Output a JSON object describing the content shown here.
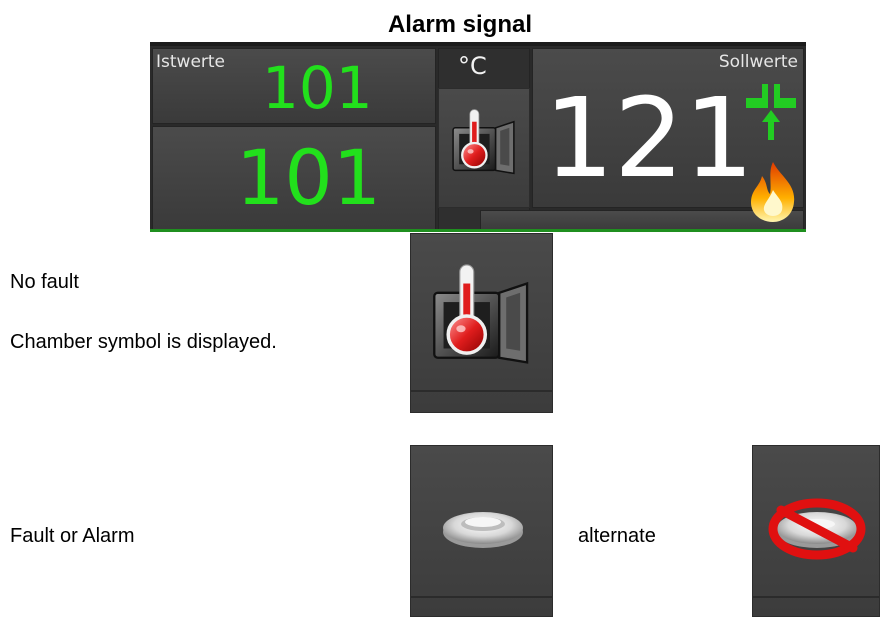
{
  "heading": "Alarm signal",
  "display": {
    "actual_label": "Istwerte",
    "setpoint_label": "Sollwerte",
    "actual_value_top": "101",
    "actual_value_bottom": "101",
    "unit": "°C",
    "setpoint_value": "121",
    "icons": [
      "thermometer-chamber-icon",
      "steam-valve-icon",
      "flame-icon"
    ]
  },
  "rows": [
    {
      "lines": [
        "No fault",
        "Chamber symbol is displayed."
      ],
      "icon": "thermometer-chamber-icon"
    },
    {
      "label": "Fault or Alarm",
      "icon_a": "lamp-icon",
      "between": "alternate",
      "icon_b": "prohibited-lamp-icon"
    }
  ],
  "colors": {
    "actual_value": "#22e01c",
    "setpoint_value": "#ffffff",
    "valve": "#22cc22",
    "alarm_red": "#e01010"
  }
}
